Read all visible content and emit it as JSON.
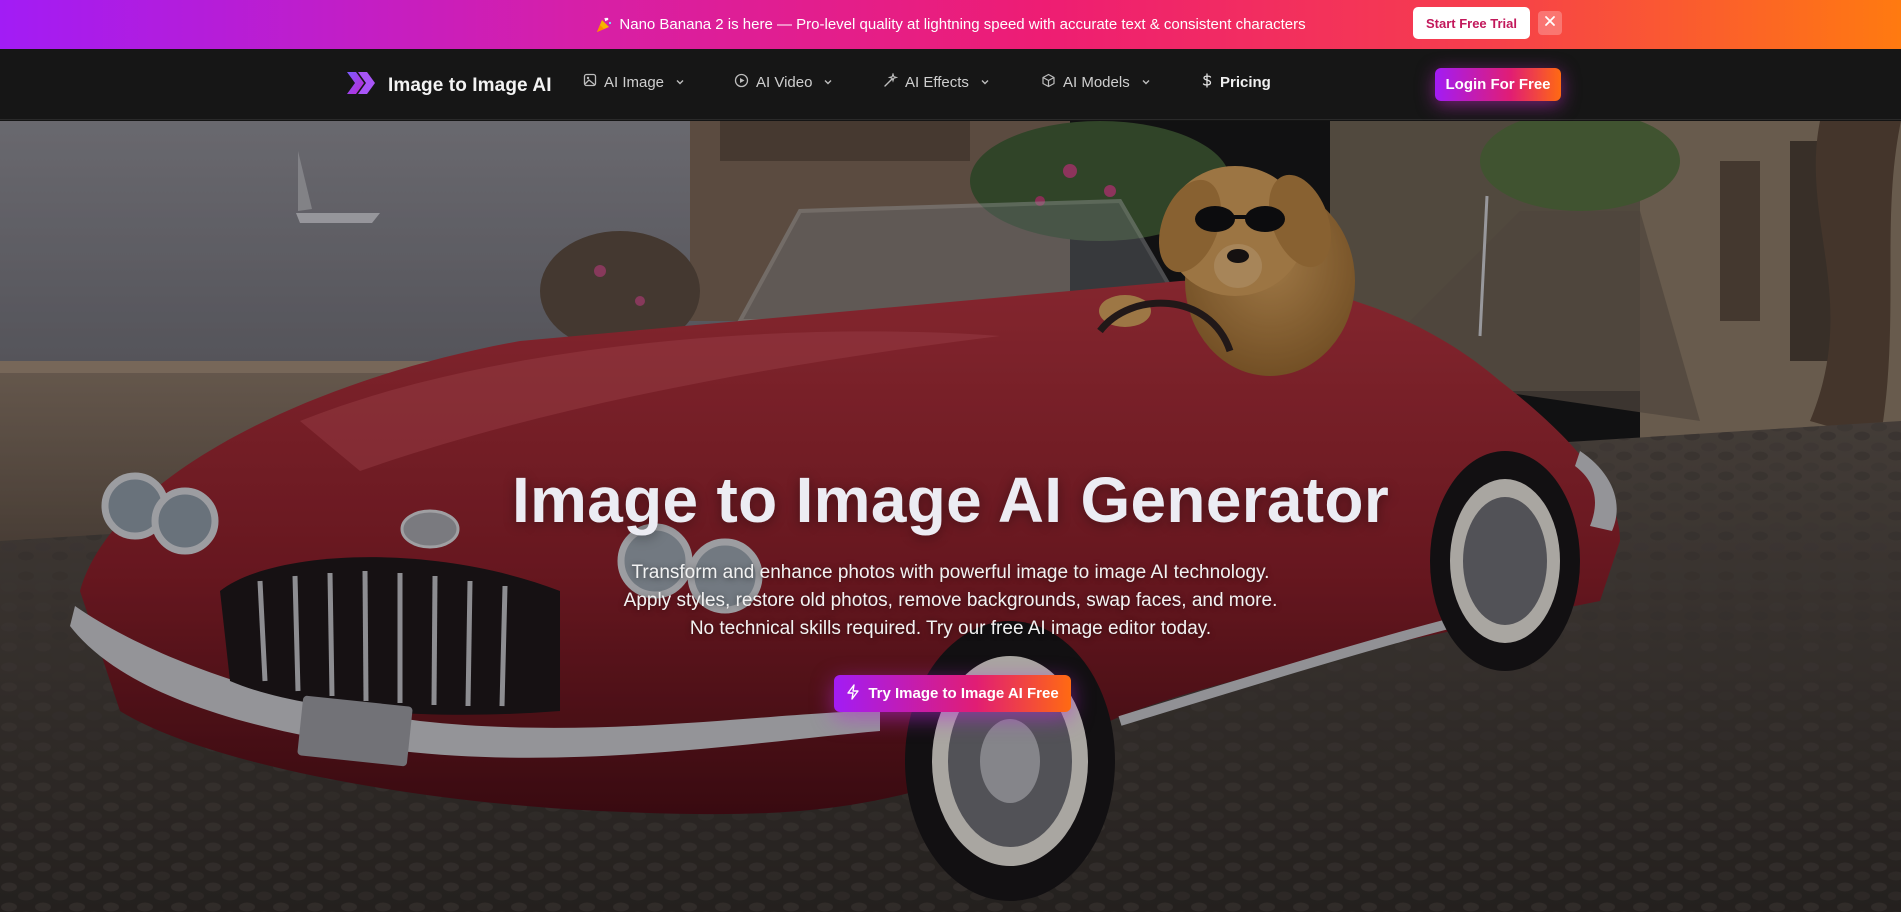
{
  "announcement": {
    "icon": "party-popper-icon",
    "text": "Nano Banana 2 is here — Pro-level quality at lightning speed with accurate text & consistent characters",
    "trial_label": "Start Free Trial",
    "close_icon": "close-icon"
  },
  "nav": {
    "brand": "Image to Image AI",
    "items": [
      {
        "label": "AI Image",
        "icon": "image-icon",
        "has_dropdown": true
      },
      {
        "label": "AI Video",
        "icon": "play-circle-icon",
        "has_dropdown": true
      },
      {
        "label": "AI Effects",
        "icon": "magic-wand-icon",
        "has_dropdown": true
      },
      {
        "label": "AI Models",
        "icon": "cube-icon",
        "has_dropdown": true
      },
      {
        "label": "Pricing",
        "icon": "dollar-icon",
        "has_dropdown": false
      }
    ],
    "login_label": "Login For Free"
  },
  "hero": {
    "title": "Image to Image AI Generator",
    "subtitle_lines": [
      "Transform and enhance photos with powerful image to image AI technology.",
      "Apply styles, restore old photos, remove backgrounds, swap faces, and more.",
      "No technical skills required. Try our free AI image editor today."
    ],
    "cta_label": "Try Image to Image AI Free",
    "cta_icon": "lightning-icon"
  },
  "colors": {
    "gradient_start": "#a21cf5",
    "gradient_mid": "#e11d74",
    "gradient_end": "#ff6a12",
    "nav_bg": "#161616"
  }
}
